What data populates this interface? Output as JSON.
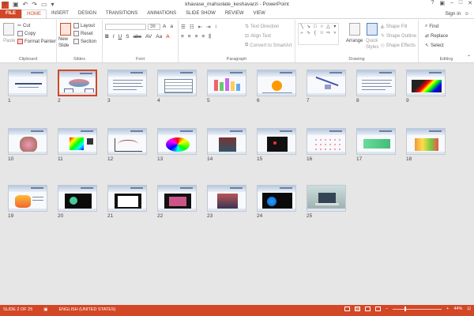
{
  "titlebar": {
    "app_logo": "P",
    "title": "khavase_mahsolate_keshavarzi - PowerPoint",
    "qat_icons": [
      "save-icon",
      "undo-icon",
      "redo-icon",
      "start-from-beginning-icon",
      "customize-qat-icon"
    ]
  },
  "tabs": [
    "FILE",
    "HOME",
    "INSERT",
    "DESIGN",
    "TRANSITIONS",
    "ANIMATIONS",
    "SLIDE SHOW",
    "REVIEW",
    "VIEW"
  ],
  "active_tab": "HOME",
  "signin": "Sign in",
  "ribbon": {
    "clipboard": {
      "label": "Clipboard",
      "paste": "Paste",
      "cut": "Cut",
      "copy": "Copy",
      "format_painter": "Format Painter"
    },
    "slides": {
      "label": "Slides",
      "new_slide": "New",
      "new_slide_2": "Slide",
      "layout": "Layout",
      "reset": "Reset",
      "section": "Section"
    },
    "font": {
      "label": "Font",
      "font_name": "",
      "font_size": "36",
      "format_buttons": [
        "B",
        "I",
        "U",
        "S",
        "abc",
        "AV",
        "Aa",
        "A"
      ]
    },
    "paragraph": {
      "label": "Paragraph",
      "text_direction": "Text Direction",
      "align_text": "Align Text",
      "convert_smartart": "Convert to SmartArt"
    },
    "drawing": {
      "label": "Drawing",
      "arrange": "Arrange",
      "quick_styles": "Quick",
      "quick_styles_2": "Styles",
      "shape_fill": "Shape Fill",
      "shape_outline": "Shape Outline",
      "shape_effects": "Shape Effects"
    },
    "editing": {
      "label": "Editing",
      "find": "Find",
      "replace": "Replace",
      "select": "Select"
    }
  },
  "slides": [
    {
      "n": "1",
      "theme": "title"
    },
    {
      "n": "2",
      "theme": "diagram"
    },
    {
      "n": "3",
      "theme": "text"
    },
    {
      "n": "4",
      "theme": "table"
    },
    {
      "n": "5",
      "theme": "bars"
    },
    {
      "n": "6",
      "theme": "orange"
    },
    {
      "n": "7",
      "theme": "arrows"
    },
    {
      "n": "8",
      "theme": "text"
    },
    {
      "n": "9",
      "theme": "spectrum"
    },
    {
      "n": "10",
      "theme": "face"
    },
    {
      "n": "11",
      "theme": "cube"
    },
    {
      "n": "12",
      "theme": "graph"
    },
    {
      "n": "13",
      "theme": "rainbow"
    },
    {
      "n": "14",
      "theme": "colorbox"
    },
    {
      "n": "15",
      "theme": "dark"
    },
    {
      "n": "16",
      "theme": "dots"
    },
    {
      "n": "17",
      "theme": "green"
    },
    {
      "n": "18",
      "theme": "fruit"
    },
    {
      "n": "19",
      "theme": "fruit2"
    },
    {
      "n": "20",
      "theme": "screen"
    },
    {
      "n": "21",
      "theme": "screen2"
    },
    {
      "n": "22",
      "theme": "screen3"
    },
    {
      "n": "23",
      "theme": "photo"
    },
    {
      "n": "24",
      "theme": "black"
    },
    {
      "n": "25",
      "theme": "laptop"
    }
  ],
  "selected_slide": "2",
  "statusbar": {
    "slide_info": "SLIDE 2 OF 25",
    "language": "ENGLISH (UNITED STATES)",
    "zoom": "44%",
    "zoom_level": 0.44
  },
  "colors": {
    "accent": "#d24726",
    "ribbon_bg": "#ffffff",
    "canvas_bg": "#e6e6e6"
  }
}
